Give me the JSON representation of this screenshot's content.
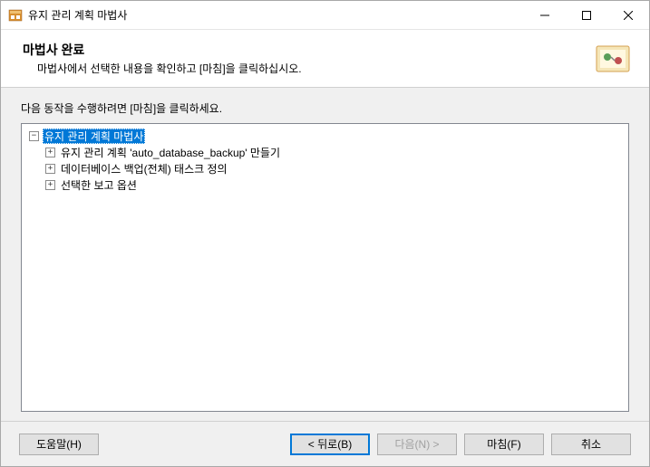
{
  "window": {
    "title": "유지 관리 계획 마법사"
  },
  "header": {
    "title": "마법사 완료",
    "subtitle": "마법사에서 선택한 내용을 확인하고 [마침]을 클릭하십시오."
  },
  "content": {
    "instruction": "다음 동작을 수행하려면 [마침]을 클릭하세요."
  },
  "tree": {
    "root": {
      "label": "유지 관리 계획 마법사",
      "children": [
        {
          "label": "유지 관리 계획 'auto_database_backup' 만들기"
        },
        {
          "label": "데이터베이스 백업(전체) 태스크 정의"
        },
        {
          "label": "선택한 보고 옵션"
        }
      ]
    }
  },
  "buttons": {
    "help": "도움말(H)",
    "back": "< 뒤로(B)",
    "next": "다음(N) >",
    "finish": "마침(F)",
    "cancel": "취소"
  }
}
